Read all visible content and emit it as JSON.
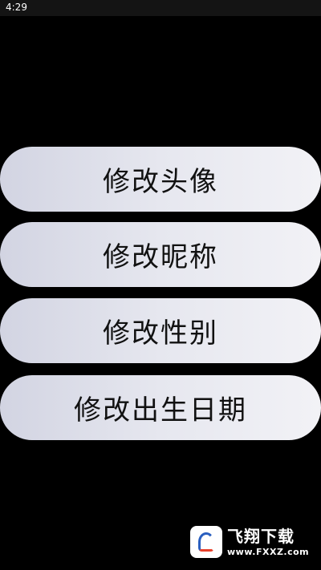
{
  "status_bar": {
    "time": "4:29"
  },
  "menu": {
    "buttons": [
      {
        "label": "修改头像"
      },
      {
        "label": "修改昵称"
      },
      {
        "label": "修改性别"
      },
      {
        "label": "修改出生日期"
      }
    ]
  },
  "watermark": {
    "title": "飞翔下载",
    "url": "www.FXXZ.com"
  },
  "colors": {
    "background": "#000000",
    "button_fill": "#e6e7ef",
    "button_text": "#111111"
  }
}
